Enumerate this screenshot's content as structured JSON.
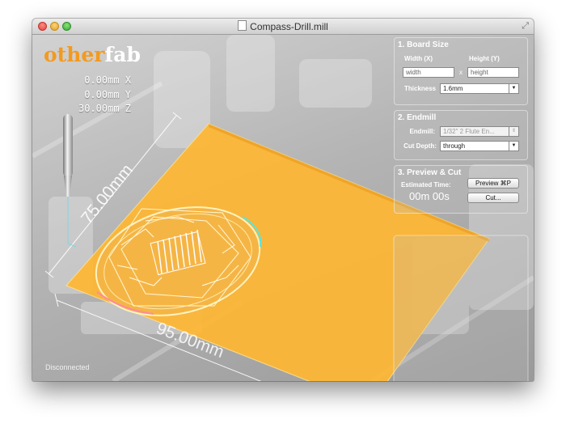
{
  "window": {
    "title": "Compass-Drill.mill"
  },
  "logo": {
    "part1": "other",
    "part2": "fab"
  },
  "position": {
    "x": "0.00mm X",
    "y": "0.00mm Y",
    "z": "30.00mm Z"
  },
  "dimensions": {
    "width": "95.00mm",
    "height": "75.00mm"
  },
  "status": "Disconnected",
  "board_size": {
    "title": "1. Board Size",
    "width_label": "Width (X)",
    "height_label": "Height (Y)",
    "width_placeholder": "width",
    "height_placeholder": "height",
    "separator": "x",
    "thickness_label": "Thickness",
    "thickness_value": "1.6mm"
  },
  "endmill": {
    "title": "2. Endmill",
    "endmill_label": "Endmill:",
    "endmill_value": "1/32\" 2 Flute En...",
    "cut_depth_label": "Cut Depth:",
    "cut_depth_value": "through"
  },
  "preview": {
    "title": "3. Preview & Cut",
    "estimated_time_label": "Estimated Time:",
    "estimated_time": "00m 00s",
    "preview_button": "Preview ⌘P",
    "cut_button": "Cut..."
  },
  "colors": {
    "board": "#ffb733",
    "accent": "#f39a1e"
  }
}
